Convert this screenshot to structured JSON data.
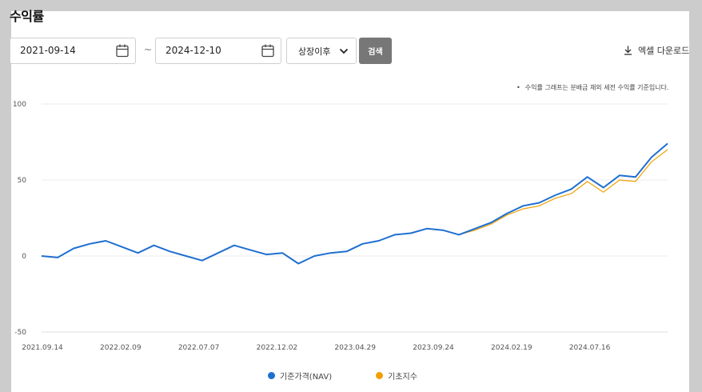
{
  "page": {
    "title": "수익률"
  },
  "filters": {
    "start_date": "2021-09-14",
    "end_date": "2024-12-10",
    "separator": "~",
    "period_selected": "상장이후",
    "search_label": "검색",
    "excel_label": "엑셀 다운로드"
  },
  "note": "수익률 그래프는 분배금 재외 세전 수익률 기준입니다.",
  "colors": {
    "nav": "#1f6fd1",
    "base": "#f0a000",
    "grid": "#eeeeee",
    "button": "#777777"
  },
  "chart_data": {
    "type": "line",
    "title": "",
    "xlabel": "",
    "ylabel": "",
    "ylim": [
      -50,
      100
    ],
    "yticks": [
      100,
      50,
      0,
      -50
    ],
    "xtick_labels": [
      "2021.09.14",
      "2022.02.09",
      "2022.07.07",
      "2022.12.02",
      "2023.04.29",
      "2023.09.24",
      "2024.02.19",
      "2024.07.16"
    ],
    "legend_position": "bottom",
    "x": [
      "2021.09",
      "2021.10",
      "2021.11",
      "2021.12",
      "2022.01",
      "2022.02",
      "2022.03",
      "2022.04",
      "2022.05",
      "2022.06",
      "2022.07",
      "2022.08",
      "2022.09",
      "2022.10",
      "2022.11",
      "2022.12",
      "2023.01",
      "2023.02",
      "2023.03",
      "2023.04",
      "2023.05",
      "2023.06",
      "2023.07",
      "2023.08",
      "2023.09",
      "2023.10",
      "2023.11",
      "2023.12",
      "2024.01",
      "2024.02",
      "2024.03",
      "2024.04",
      "2024.05",
      "2024.06",
      "2024.07",
      "2024.08",
      "2024.09",
      "2024.10",
      "2024.11",
      "2024.12"
    ],
    "series": [
      {
        "name": "기준가격(NAV)",
        "color": "#1f6fd1",
        "values": [
          0,
          -1,
          5,
          8,
          10,
          6,
          2,
          7,
          3,
          0,
          -3,
          2,
          7,
          4,
          1,
          2,
          -5,
          0,
          2,
          3,
          8,
          10,
          14,
          15,
          18,
          17,
          14,
          18,
          22,
          28,
          33,
          35,
          40,
          44,
          52,
          45,
          53,
          52,
          65,
          74
        ]
      },
      {
        "name": "기초지수",
        "color": "#f0a000",
        "values": [
          0,
          -1,
          5,
          8,
          10,
          6,
          2,
          7,
          3,
          0,
          -3,
          2,
          7,
          4,
          1,
          2,
          -5,
          0,
          2,
          3,
          8,
          10,
          14,
          15,
          18,
          17,
          14,
          17,
          21,
          27,
          31,
          33,
          38,
          41,
          49,
          42,
          50,
          49,
          62,
          70
        ]
      }
    ]
  }
}
